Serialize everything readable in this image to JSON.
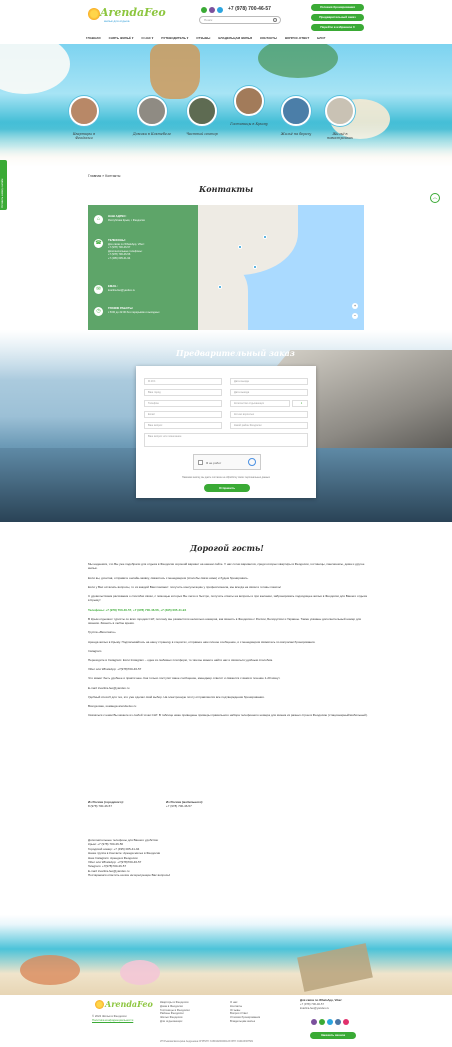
{
  "header": {
    "logo_text": "ArendaFeo",
    "logo_tagline": "жильё для отдыха",
    "phone": "+7 (978) 700-46-57",
    "search_placeholder": "Поиск",
    "buttons": [
      "Условия бронирования",
      "Предварительный заказ",
      "Перейти в избранное"
    ],
    "favorites_count": "0",
    "nav": [
      "ГЛАВНАЯ",
      "СНЯТЬ ЖИЛЬЁ ▾",
      "О НАС ▾",
      "ПУТЕВОДИТЕЛЬ ▾",
      "ОТЗЫВЫ",
      "ВЛАДЕЛЬЦАМ ЖИЛЬЯ",
      "КОНТАКТЫ",
      "ВОПРОС-ОТВЕТ",
      "БЛОГ"
    ]
  },
  "categories": [
    "Квартиры в Феодосии",
    "Домики в Коктебеле",
    "Частный сектор",
    "Гостиницы в Крыму",
    "Жильё на берегу",
    "Жильё в новостройках"
  ],
  "side_tab": "Оставить заявку онлайн",
  "breadcrumb": "Главная » Контакты",
  "contacts": {
    "title": "Контакты",
    "address_label": "НАШ АДРЕС:",
    "address": "Республика Крым, г. Феодосия",
    "phones_label": "ТЕЛЕФОНЫ:",
    "phones": [
      "Для связи по WhatsApp, Viber:",
      "+7 (978) 700-46-57",
      "Дополнительные телефоны:",
      "+7 (978) 700-46-56",
      "+7 (495) 005-41-94"
    ],
    "email_label": "EMAIL:",
    "email": "kvartira-feo@yandex.ru",
    "hours_label": "ГРАФИК РАБОТЫ:",
    "hours": "с 8:00 до 22:00 без перерывов и выходных"
  },
  "order": {
    "title": "Предварительный заказ",
    "fields": [
      "Ф.И.О.",
      "Дата въезда",
      "Ваш город",
      "Дата выезда",
      "Телефон",
      "Количество отдыхающих",
      "Email",
      "Кол-во взрослых",
      "Ваш вопрос",
      "Какой район Феодосии",
      "Ваш вопрос или пожелание"
    ],
    "guests_value": "1",
    "captcha_label": "Я не робот",
    "consent": "Нажимая кнопку, вы даёте согласие на обработку своих персональных данных",
    "submit": "Отправить"
  },
  "article": {
    "title": "Дорогой гость!",
    "p1": "Мы надеемся, что Вы уже подобрали для отдыха в Феодосии хороший вариант на нашем сайте. У нас сотни вариантов, среди которых квартиры в Феодосии, гостиницы, пансионаты, дома и другое жильё.",
    "p2": "Если вы, дочитав, отправите онлайн-заявку, свяжитесь с менеджером (способы связи ниже) и будем бронировать.",
    "p3": "Если у Вас остались вопросы, то из каждой Вам поможет: получить консультацию у профессионала, мы всегда на связи и готовы помочь!",
    "p4": "С удовольствием расскажем о способах связи, с помощью которых Вы легко и быстро, получить ответы на вопросы и при желании, забронировать подходящее жильё в Феодосии для Вашего отдыха в Крыму!",
    "b1": "Телефоны: +7 (978) 700-46-57, +7 (978) 700-46-56, +7 (495) 005-41-94",
    "p5": "В Крым отдыхают туристы со всех городов СНГ, поэтому мы разместили несколько номеров, как звонить в Феодосию с России, Белоруссии и Украины. Также указаны дополнительный номер для звонков. Звонить в любое время.",
    "b2": "Группа «Вконтакте»",
    "p6": "Аренда жилья в Крыму. Подписывайтесь на нашу страницу в соцсетях, отправьте нам личное сообщение, и с менеджером свяжитесь по вопросам бронирования.",
    "b3": "Instagram",
    "p7": "Переходите в Instagram: Если Instagram – одна из любимых платформ, то там вы можете найти нас и связаться удобным способом.",
    "b4": "Viber или WhatsApp: +7(978)700-46-57",
    "p8": "Что может быть удобнее и практичнее. Как только поступит ваше сообщение, менеджер ответит и свяжется с вами в течение 1-20 минут.",
    "b5": "E-mail: kvartira-feo@yandex.ru",
    "p9": "Удобный способ для тех, кто уже сделал свой выбор. На электронную почту отправляются все подтверждения бронирования.",
    "p10": "Всегда ваш, команда arenda-feo.ru",
    "p11": "Связаться с нами Вы можете из любой точки СНГ. В таблице ниже приведены примеры правильного набора телефонного номера для звонка из разных стран в Феодосию (стационарный/мобильный).",
    "t_ru_h": "Из России (городского):",
    "t_ru_v": "8 (978) 700-46-57",
    "t_ua_h": "Из России (мобильного):",
    "t_ua_v": "+7 (978) 700-46-57",
    "extra": [
      "Дополнительные телефоны для Вашего удобства:",
      "Крым: +7 (978) 700-46-56",
      "Городской номер: +7 (495) 005-41-94",
      "Наша группа в Контакте: Аренда жилья в Феодосии",
      "Наш Instagram: Аренда в Феодосии",
      "Viber или WhatsApp: +7(978)700-46-57",
      "Telegram: +7(978)700-46-57",
      "E-mail: kvartira-feo@yandex.ru",
      "Постараемся ответить на все интересующие Вас вопросы!"
    ]
  },
  "footer": {
    "copy": "© 2024 Жильё в Феодосии",
    "policy": "Политика конфиденциальности",
    "col1": [
      "Квартиры в Феодосии",
      "Дома в Феодосии",
      "Гостиницы в Феодосии",
      "Районы Феодосии",
      "Жильё Феодосия",
      "Для отдыхающих"
    ],
    "col2": [
      "О нас",
      "Контакты",
      "Отзывы",
      "Вопрос-Ответ",
      "Условия бронирования",
      "Владельцам жилья"
    ],
    "contact_h": "Для связи по WhatsApp, Viber:",
    "contact_phone": "+7 (978) 700-46-57",
    "contact_email": "kvartira-feo@yandex.ru",
    "order_btn": "Заказать звонок",
    "bottom": "ИП Рыжова Екатерина Андреевна ОГРНИП: 315910200000123 ИНН: 910103367581"
  }
}
